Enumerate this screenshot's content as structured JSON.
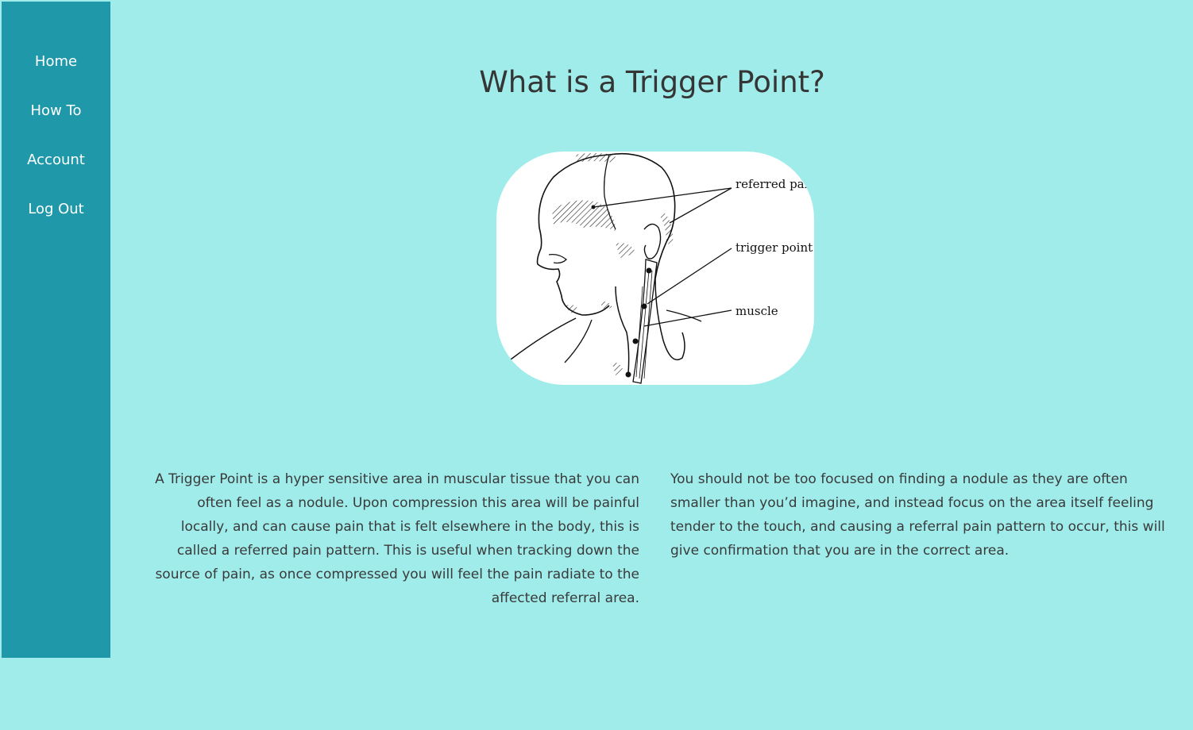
{
  "sidebar": {
    "items": [
      {
        "label": "Home"
      },
      {
        "label": "How To"
      },
      {
        "label": "Account"
      },
      {
        "label": "Log Out"
      }
    ]
  },
  "main": {
    "title": "What is a Trigger Point?",
    "diagram": {
      "labels": {
        "referred_pain": "referred pain",
        "trigger_point": "trigger point",
        "muscle": "muscle"
      }
    },
    "paragraphs": {
      "left": "A Trigger Point is a hyper sensitive area in muscular tissue that you can often feel as a nodule. Upon compression this area will be painful locally, and can cause pain that is felt elsewhere in the body, this is called a referred pain pattern. This is useful when tracking down the source of pain, as once compressed you will feel the pain radiate to the affected referral area.",
      "right": "You should not be too focused on finding a nodule as they are often smaller than you’d imagine, and instead focus on the area itself feeling tender to the touch, and causing a referral pain pattern to occur, this will give confirmation that you are in the correct area."
    }
  },
  "colors": {
    "background": "#9fecea",
    "sidebar": "#1f98a9",
    "nav_text": "#ffffff",
    "body_text": "#3a3a3a"
  }
}
